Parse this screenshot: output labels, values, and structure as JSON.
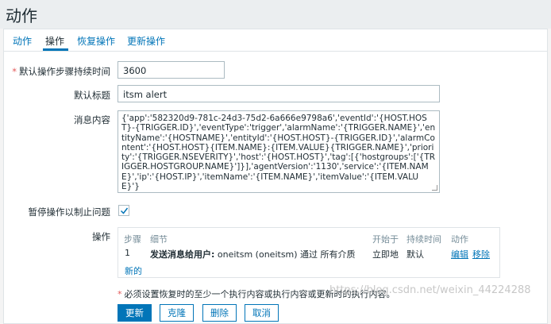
{
  "page": {
    "title": "动作"
  },
  "tabs": [
    {
      "label": "动作",
      "active": false
    },
    {
      "label": "操作",
      "active": true
    },
    {
      "label": "恢复操作",
      "active": false
    },
    {
      "label": "更新操作",
      "active": false
    }
  ],
  "form": {
    "step_duration": {
      "label": "默认操作步骤持续时间",
      "value": "3600",
      "required_mark": "*"
    },
    "subject": {
      "label": "默认标题",
      "value": "itsm alert"
    },
    "message": {
      "label": "消息内容",
      "value": "{'app':'582320d9-781c-24d3-75d2-6a666e9798a6','eventId':'{HOST.HOST}-{TRIGGER.ID}','eventType':'trigger','alarmName':'{TRIGGER.NAME}','entityName':'{HOSTNAME}','entityId':'{HOST.HOST}-{TRIGGER.ID}','alarmContent':'{HOST.HOST}{ITEM.NAME}:{ITEM.VALUE}{TRIGGER.NAME}','priority':'{TRIGGER.NSEVERITY}','host':'{HOST.HOST}','tag':[{'hostgroups':['{TRIGGER.HOSTGROUP.NAME}']}],'agentVersion':'1130','service':'{ITEM.NAME}','ip':'{HOST.IP}','itemName':'{ITEM.NAME}','itemValue':'{ITEM.VALUE}'}"
    },
    "pause": {
      "label": "暂停操作以制止问题",
      "checked": true
    },
    "operations": {
      "label": "操作",
      "columns": [
        "步骤",
        "细节",
        "开始于",
        "持续时间",
        "动作"
      ],
      "rows": [
        {
          "step": "1",
          "detail_bold": "发送消息给用户:",
          "detail_rest": " oneitsm (oneitsm) 通过 所有介质",
          "start": "立即地",
          "duration": "默认",
          "edit": "编辑",
          "remove": "移除"
        }
      ],
      "new_link": "新的"
    },
    "note": {
      "mark": "*",
      "text": "必须设置恢复时的至少一个执行内容或执行内容或更新时的执行内容。"
    }
  },
  "buttons": {
    "update": "更新",
    "clone": "克隆",
    "delete": "删除",
    "cancel": "取消"
  },
  "watermark": "https://blog.csdn.net/weixin_44224288",
  "colors": {
    "accent": "#0275b8",
    "required": "#e45959",
    "header_bg": "#ebeef0"
  }
}
